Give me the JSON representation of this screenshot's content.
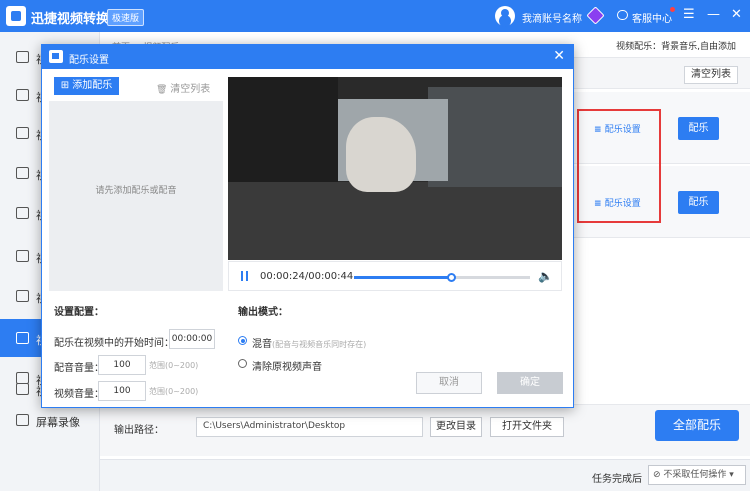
{
  "app": {
    "title": "迅捷视频转换器",
    "edition": "极速版",
    "account": "我滴账号名称",
    "customer_service": "客服中心",
    "menu_glyph": "☰",
    "minimize_glyph": "—",
    "close_glyph": "✕"
  },
  "sidebar": {
    "items": [
      {
        "label": "视",
        "icon": "video-convert-icon"
      },
      {
        "label": "视",
        "icon": "audio-icon"
      },
      {
        "label": "视",
        "icon": "play-icon"
      },
      {
        "label": "视",
        "icon": "gif-icon"
      },
      {
        "label": "视",
        "icon": "person-icon"
      },
      {
        "label": "视",
        "icon": "watermark-icon"
      },
      {
        "label": "视",
        "icon": "image-icon"
      },
      {
        "label": "视",
        "icon": "music-icon"
      },
      {
        "label": "视",
        "icon": "split-icon"
      },
      {
        "label": "视",
        "icon": "more-icon"
      },
      {
        "label": "屏幕录像",
        "icon": "record-icon"
      }
    ]
  },
  "main": {
    "breadcrumb": "首页 > 视频配乐",
    "mode_text": "视频配乐：背景音乐,自由添加",
    "clear_all": "清空列表",
    "rows": [
      {
        "setting_label": "配乐设置",
        "button_label": "配乐"
      },
      {
        "setting_label": "配乐设置",
        "button_label": "配乐"
      }
    ],
    "output_label": "输出路径：",
    "output_path": "C:\\Users\\Administrator\\Desktop",
    "change_dir": "更改目录",
    "open_dir": "打开文件夹",
    "all_button": "全部配乐",
    "after_task_label": "任务完成后",
    "after_task_value": "⊘ 不采取任何操作 ▾"
  },
  "dialog": {
    "title": "配乐设置",
    "close_glyph": "✕",
    "add_button": "添加配乐",
    "clear_list": "清空列表",
    "empty_hint": "请先添加配乐或配音",
    "settings_title": "设置配置：",
    "start_time_label": "配乐在视频中的开始时间：",
    "start_time_value": "00:00:00",
    "music_volume_label": "配音音量：",
    "music_volume_value": "100",
    "music_volume_range": "范围(0~200)",
    "video_volume_label": "视频音量：",
    "video_volume_value": "100",
    "video_volume_range": "范围(0~200)",
    "playback_time": "00:00:24/00:00:44",
    "playback_progress": 0.55,
    "output_mode_title": "输出模式：",
    "mix_label": "混音",
    "mix_hint": "(配音与视频音乐同时存在)",
    "clear_label": "清除原视频声音",
    "cancel": "取消",
    "ok": "确定"
  },
  "colors": {
    "accent": "#2d7df2",
    "highlight_box": "#e63a3a"
  }
}
